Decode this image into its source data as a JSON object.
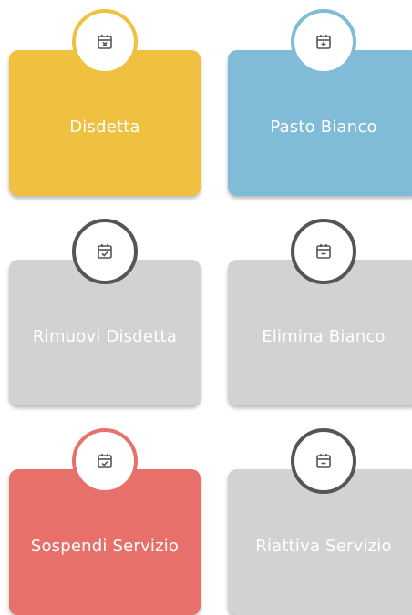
{
  "tiles": [
    {
      "label": "Disdetta",
      "icon": "calendar-x-icon",
      "bg": "#F0C040",
      "ring": "#F0C040"
    },
    {
      "label": "Pasto Bianco",
      "icon": "calendar-plus-icon",
      "bg": "#80BCD8",
      "ring": "#80BCD8"
    },
    {
      "label": "Rimuovi Disdetta",
      "icon": "calendar-check-icon",
      "bg": "#D2D2D2",
      "ring": "#555555"
    },
    {
      "label": "Elimina Bianco",
      "icon": "calendar-minus-icon",
      "bg": "#D2D2D2",
      "ring": "#555555"
    },
    {
      "label": "Sospendi Servizio",
      "icon": "calendar-check-icon",
      "bg": "#E8706A",
      "ring": "#E8706A"
    },
    {
      "label": "Riattiva Servizio",
      "icon": "calendar-minus-icon",
      "bg": "#D2D2D2",
      "ring": "#555555"
    }
  ]
}
